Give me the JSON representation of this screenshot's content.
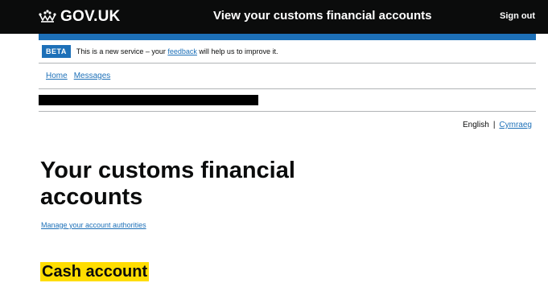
{
  "header": {
    "logo_text": "GOV.UK",
    "logo_icon": "crown-icon",
    "service_name": "View your customs financial accounts",
    "sign_out_label": "Sign out"
  },
  "phase_banner": {
    "tag": "BETA",
    "text_before": "This is a new service – your ",
    "feedback_link": "feedback",
    "text_after": " will help us to improve it."
  },
  "nav": {
    "items": [
      {
        "label": "Home"
      },
      {
        "label": "Messages"
      }
    ]
  },
  "language": {
    "current": "English",
    "separator": "|",
    "alternate": "Cymraeg"
  },
  "main": {
    "title": "Your customs financial accounts",
    "manage_link": "Manage your account authorities",
    "section_heading": "Cash account"
  },
  "colors": {
    "header_bg": "#0b0c0c",
    "brand_blue": "#1d70b8",
    "link": "#1d70b8",
    "highlight": "#ffdd00",
    "border": "#b1b4b6"
  }
}
